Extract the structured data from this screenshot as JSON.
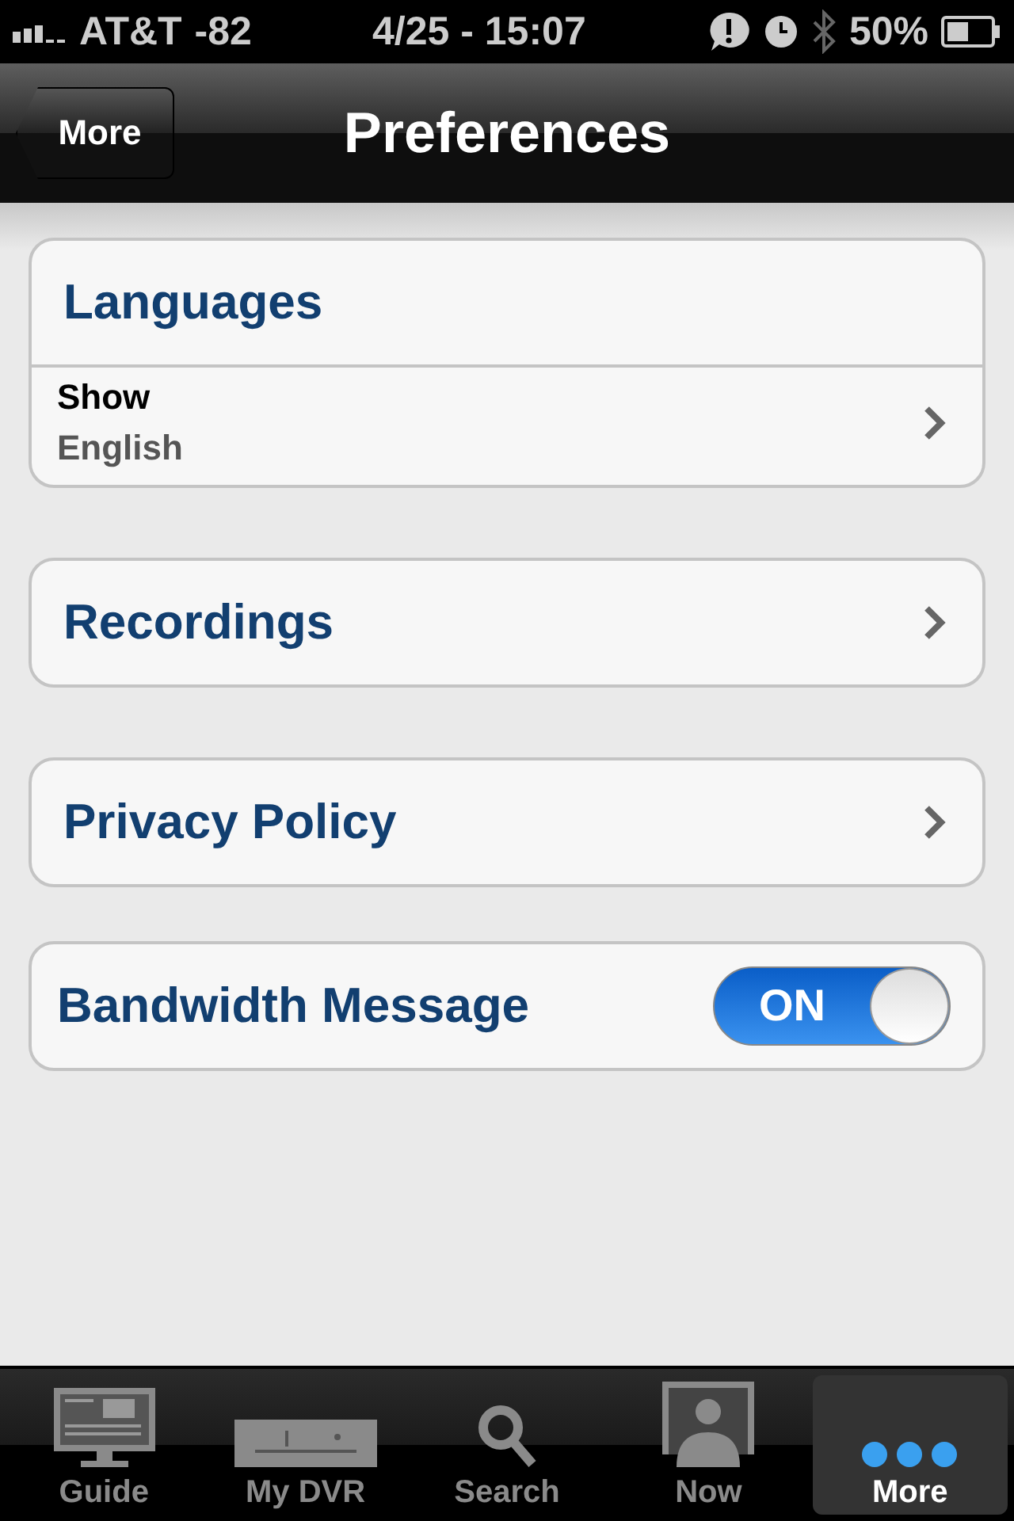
{
  "status_bar": {
    "carrier": "AT&T",
    "signal_reading": "-82",
    "time": "4/25 - 15:07",
    "battery": "50%"
  },
  "nav": {
    "back": "More",
    "title": "Preferences"
  },
  "sections": [
    {
      "kind": "detail",
      "title": "Languages",
      "label": "Show",
      "value": "English"
    },
    {
      "kind": "link",
      "title": "Recordings"
    },
    {
      "kind": "link",
      "title": "Privacy Policy"
    },
    {
      "kind": "toggle",
      "title": "Bandwidth Message",
      "on": true,
      "on_text": "ON"
    }
  ],
  "tabs": [
    {
      "kind": "guide",
      "label": "Guide",
      "selected": false
    },
    {
      "kind": "dvr",
      "label": "My DVR",
      "selected": false
    },
    {
      "kind": "search",
      "label": "Search",
      "selected": false
    },
    {
      "kind": "now",
      "label": "Now",
      "selected": false
    },
    {
      "kind": "more",
      "label": "More",
      "selected": true
    }
  ]
}
